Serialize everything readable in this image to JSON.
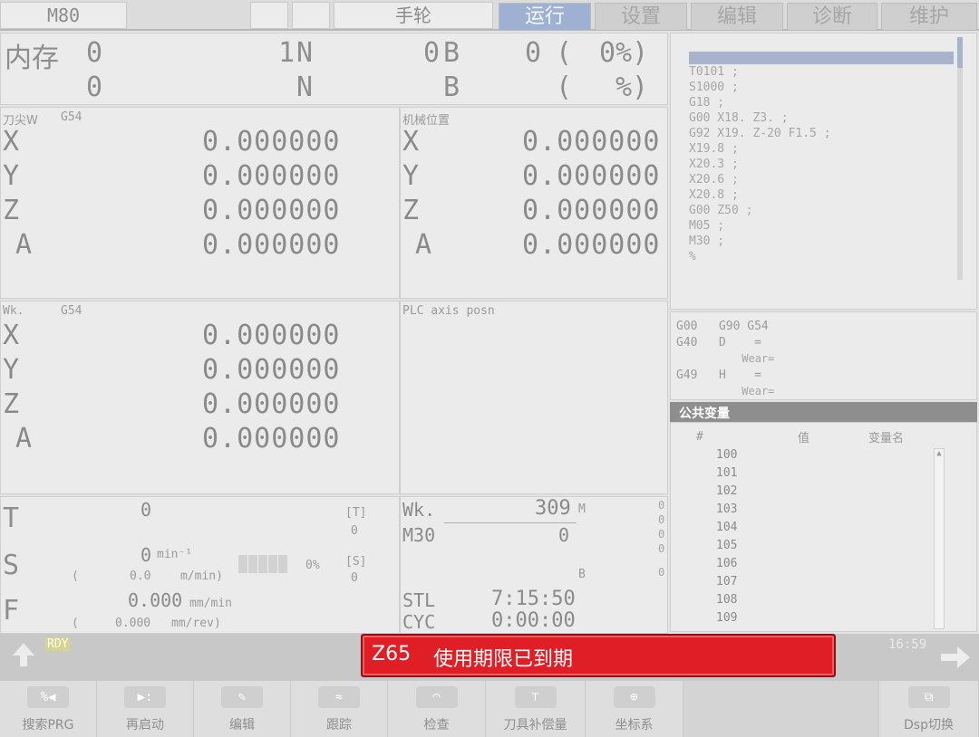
{
  "topbar": {
    "model": "M80",
    "mode": "手轮",
    "tabs": [
      "运行",
      "设置",
      "编辑",
      "诊断",
      "维护"
    ],
    "active_tab": 0
  },
  "memory": {
    "label": "内存",
    "row1": {
      "a": "0",
      "b": "1",
      "n": "N",
      "c": "0",
      "bl": "B",
      "d": "0",
      "paren": "(",
      "pct": "0%)"
    },
    "row2": {
      "a": "0",
      "n": "N",
      "bl": "B",
      "paren": "(",
      "pct": "%)"
    }
  },
  "tip_pos": {
    "header": "刀尖W",
    "code": "G54",
    "axes": [
      {
        "name": "X",
        "value": "0.000000"
      },
      {
        "name": "Y",
        "value": "0.000000"
      },
      {
        "name": "Z",
        "value": "0.000000"
      },
      {
        "name": "A",
        "value": "0.000000"
      }
    ]
  },
  "machine_pos": {
    "header": "机械位置",
    "axes": [
      {
        "name": "X",
        "value": "0.000000"
      },
      {
        "name": "Y",
        "value": "0.000000"
      },
      {
        "name": "Z",
        "value": "0.000000"
      },
      {
        "name": "A",
        "value": "0.000000"
      }
    ]
  },
  "work_pos": {
    "header": "Wk.",
    "code": "G54",
    "axes": [
      {
        "name": "X",
        "value": "0.000000"
      },
      {
        "name": "Y",
        "value": "0.000000"
      },
      {
        "name": "Z",
        "value": "0.000000"
      },
      {
        "name": "A",
        "value": "0.000000"
      }
    ]
  },
  "plc": {
    "header": "PLC axis posn"
  },
  "program": {
    "lines": [
      "T0101 ;",
      "S1000 ;",
      "G18 ;",
      "G00 X18. Z3. ;",
      "G92 X19. Z-20 F1.5 ;",
      "X19.8 ;",
      "X20.3 ;",
      "X20.6 ;",
      "X20.8 ;",
      "G00 Z50 ;",
      "M05 ;",
      "M30 ;",
      "%"
    ]
  },
  "modal": {
    "l1": "G00   G90 G54",
    "l2": "G40   D    =",
    "l3": "          Wear=",
    "l4": "G49   H    =",
    "l5": "          Wear="
  },
  "vars": {
    "title": "公共变量",
    "col_hash": "#",
    "col_val": "值",
    "col_name": "变量名",
    "rows": [
      "100",
      "101",
      "102",
      "103",
      "104",
      "105",
      "106",
      "107",
      "108",
      "109"
    ]
  },
  "tsf": {
    "t_label": "T",
    "t_value": "0",
    "t_bracket": "[T]",
    "t_sub": "0",
    "s_label": "S",
    "s_value": "0",
    "s_unit": "min⁻¹",
    "s_paren": "(",
    "s_sub": "0.0",
    "s_subunit": "m/min)",
    "s_pct": "0%",
    "s_bracket": "[S]",
    "s_sub2": "0",
    "f_label": "F",
    "f_value": "0.000",
    "f_unit": "mm/min",
    "f_paren": "(",
    "f_sub": "0.000",
    "f_subunit": "mm/rev)"
  },
  "prog_info": {
    "wk": "Wk.",
    "wk_value": "309",
    "m_label": "M",
    "m30": "M30",
    "m30_value": "0",
    "b_label": "B",
    "m_vals": [
      "0",
      "0",
      "0",
      "0",
      "0"
    ],
    "stl": "STL",
    "stl_value": "7:15:50",
    "cyc": "CYC",
    "cyc_value": "0:00:00"
  },
  "status": {
    "rdy": "RDY",
    "time": "16:59"
  },
  "alarm": {
    "code": "Z65",
    "message": "使用期限已到期",
    "color": "#e01e26"
  },
  "softkeys": [
    "搜索PRG",
    "再启动",
    "编辑",
    "跟踪",
    "检查",
    "刀具补偿量",
    "坐标系",
    "",
    "Dsp切换"
  ]
}
